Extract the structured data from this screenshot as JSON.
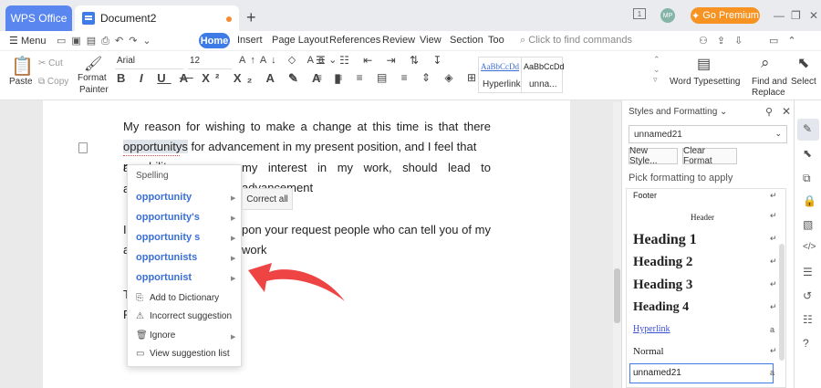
{
  "tabs": {
    "app": "WPS Office",
    "document": "Document2",
    "new_tab": "+"
  },
  "title_icons": {
    "page": "1",
    "avatar": "MP",
    "premium": "Go Premium",
    "minimize": "—",
    "restore": "❐",
    "close": "✕"
  },
  "menu_bar": {
    "menu": "Menu",
    "tabs": [
      "Home",
      "Insert",
      "Page Layout",
      "References",
      "Review",
      "View",
      "Section",
      "Too"
    ],
    "find": "Click to find commands"
  },
  "ribbon": {
    "paste": "Paste",
    "cut": "Cut",
    "copy": "Copy",
    "format_painter": [
      "Format",
      "Painter"
    ],
    "font_name": "Arial",
    "font_size": "12",
    "styles": [
      {
        "preview": "AaBbCcDd",
        "label": "Hyperlink"
      },
      {
        "preview": "AaBbCcDd",
        "label": "unna..."
      }
    ],
    "word_typesetting": "Word Typesetting",
    "find_replace": [
      "Find and",
      "Replace"
    ],
    "select": "Select"
  },
  "document": {
    "para1_line1": "My reason for wishing to make a change at this time is that there seems no",
    "para1_word": "opportunitys",
    "para1_line2_rest": " for advancement in my present position, and I feel that my ability",
    "para1_line3_frag": "my interest in my work, should lead to advancement",
    "para1_line4_frag": "a",
    "para2_line1_frag": "pon your request people who can tell you of my work",
    "para2_line1_start": "I",
    "para2_line2_frag": "a",
    "para3_start": "T",
    "para4_start": "F"
  },
  "spelling_menu": {
    "title": "Spelling",
    "suggestions": [
      "opportunity",
      "opportunity's",
      "opportunity s",
      "opportunists",
      "opportunist"
    ],
    "actions": [
      "Add to Dictionary",
      "Incorrect suggestion",
      "Ignore",
      "View suggestion list"
    ],
    "correct_all": "Correct all"
  },
  "styles_panel": {
    "title": "Styles and Formatting",
    "current_style": "unnamed21",
    "new_style": "New Style...",
    "clear_format": "Clear Format",
    "pick_label": "Pick formatting to apply",
    "styles": [
      "Footer",
      "Header",
      "Heading 1",
      "Heading 2",
      "Heading 3",
      "Heading 4",
      "Hyperlink",
      "Normal",
      "unnamed21"
    ]
  },
  "colors": {
    "accent": "#3f7be6",
    "premium": "#f79322",
    "arrow": "#ef4444",
    "suggestion": "#3a6fd8"
  }
}
